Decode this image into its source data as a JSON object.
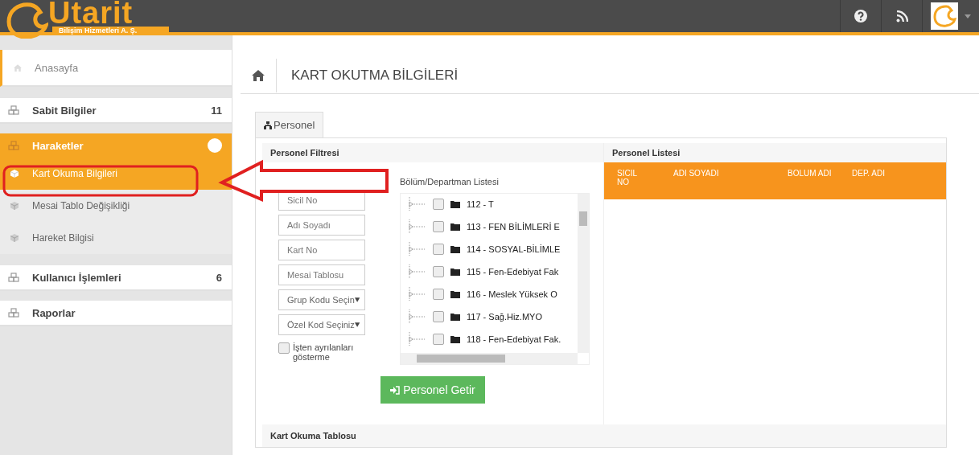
{
  "header": {
    "logo_text": "Utarit",
    "logo_subtitle": "Bilişim Hizmetleri A. Ş."
  },
  "sidebar": {
    "items": [
      {
        "label": "Anasayfa",
        "kind": "home",
        "expanded": false
      },
      {
        "label": "Sabit Bilgiler",
        "kind": "group",
        "count": "11",
        "expanded": false
      },
      {
        "label": "Haraketler",
        "kind": "group",
        "expanded": true,
        "children": [
          {
            "label": "Kart Okuma Bilgileri",
            "selected": true
          },
          {
            "label": "Mesai Tablo Değişikliği",
            "selected": false
          },
          {
            "label": "Hareket Bilgisi",
            "selected": false
          }
        ]
      },
      {
        "label": "Kullanıcı İşlemleri",
        "kind": "group",
        "count": "6",
        "expanded": false
      },
      {
        "label": "Raporlar",
        "kind": "group",
        "expanded": false
      }
    ]
  },
  "page_title": "KART OKUTMA BİLGİLERİ",
  "tabs": [
    {
      "label": "Personel",
      "selected": true
    }
  ],
  "filter": {
    "title": "Personel Filtresi",
    "fields": [
      {
        "kind": "text",
        "placeholder": "Sicil No"
      },
      {
        "kind": "text",
        "placeholder": "Adı Soyadı"
      },
      {
        "kind": "text",
        "placeholder": "Kart No"
      },
      {
        "kind": "text",
        "placeholder": "Mesai Tablosu"
      },
      {
        "kind": "select",
        "value": "Grup Kodu Seçin"
      },
      {
        "kind": "select",
        "value": "Özel Kod Seçiniz"
      }
    ],
    "checkbox": {
      "label": "İşten ayrılanları gösterme",
      "checked": false
    },
    "tree_title": "Bölüm/Departman Listesi",
    "tree": [
      {
        "label": "112 - T",
        "checked": false
      },
      {
        "label": "113 - FEN BİLİMLERİ E",
        "checked": false
      },
      {
        "label": "114 - SOSYAL-BİLİMLE",
        "checked": false
      },
      {
        "label": "115 - Fen-Edebiyat Fak",
        "checked": false
      },
      {
        "label": "116 - Meslek Yüksek O",
        "checked": false
      },
      {
        "label": "117 - Sağ.Hiz.MYO",
        "checked": false
      },
      {
        "label": "118 - Fen-Edebiyat Fak.",
        "checked": false
      }
    ],
    "button": "Personel Getir"
  },
  "list": {
    "title": "Personel Listesi",
    "columns": [
      "SICIL NO",
      "ADI SOYADI",
      "BOLUM ADI",
      "DEP. ADI"
    ]
  },
  "bottom_title": "Kart Okuma Tablosu"
}
